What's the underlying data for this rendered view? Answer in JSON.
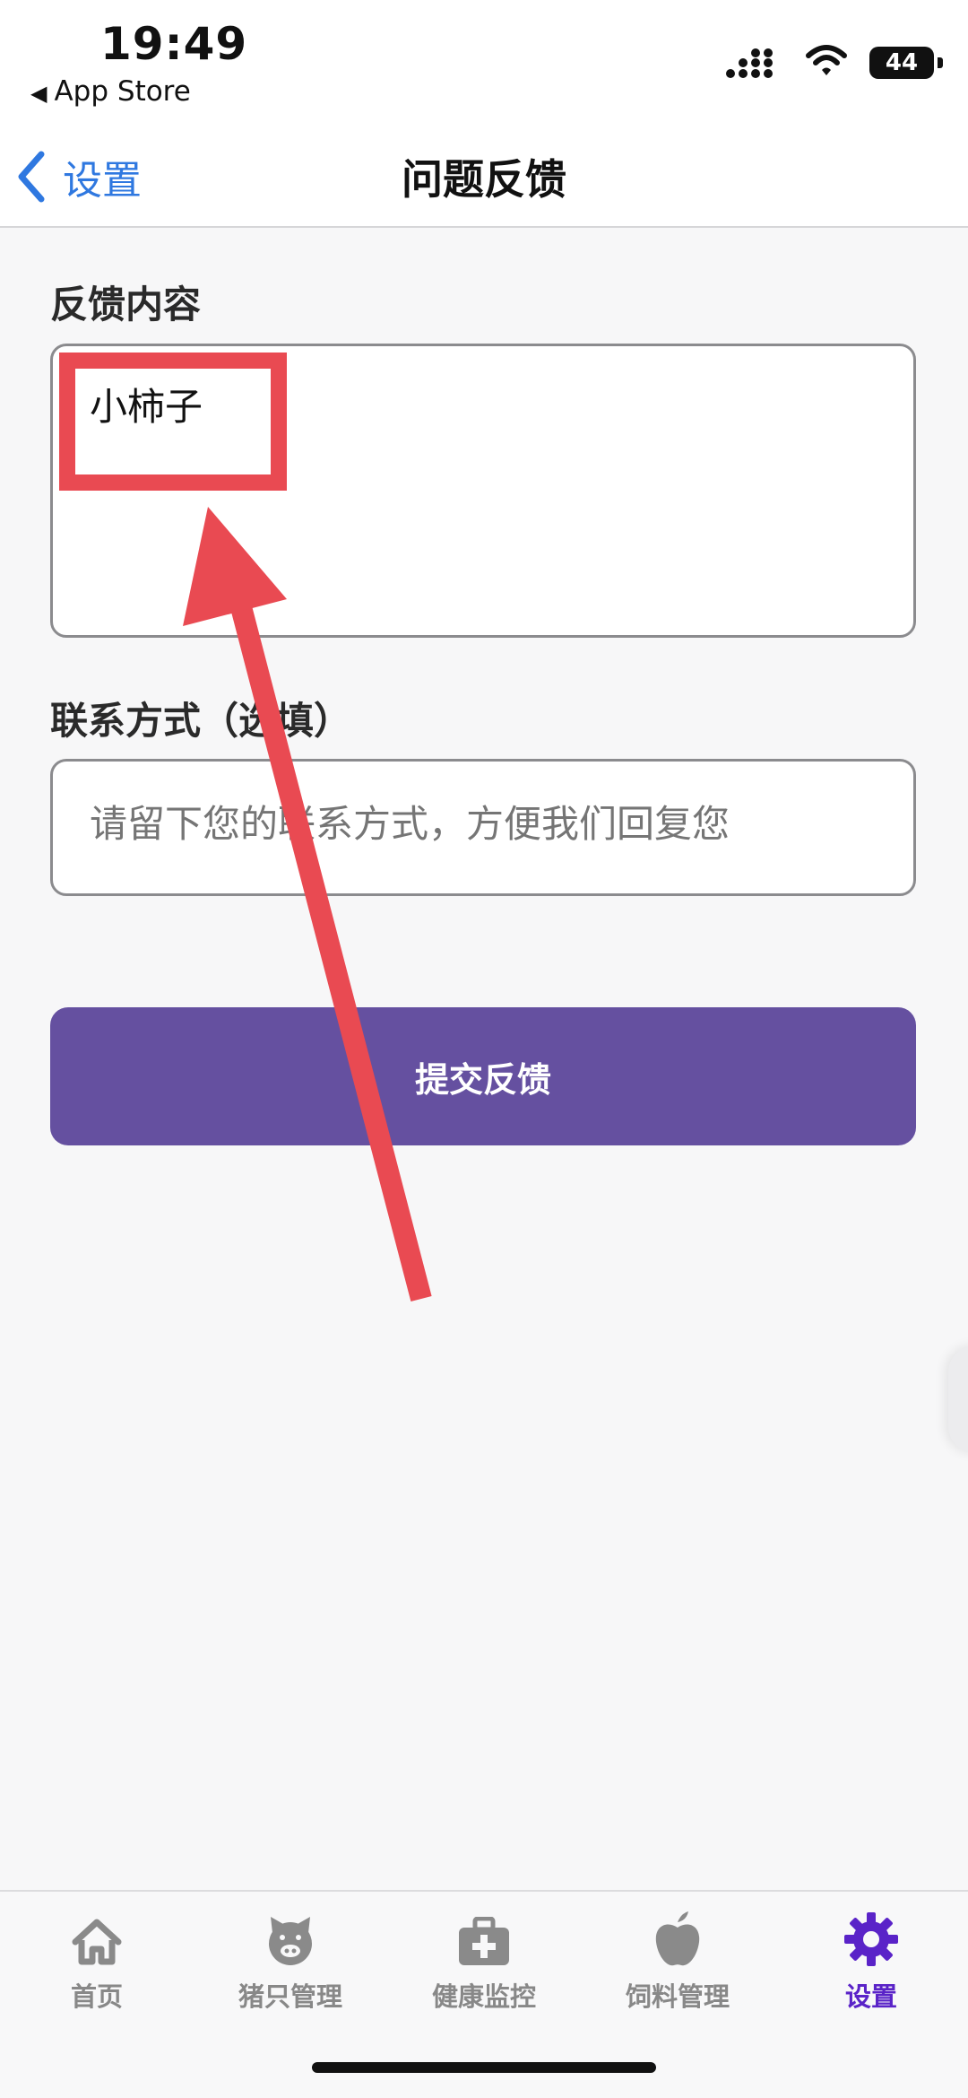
{
  "status": {
    "time": "19:49",
    "back_app": "App Store",
    "battery": "44"
  },
  "nav": {
    "back_label": "设置",
    "title": "问题反馈"
  },
  "form": {
    "feedback_label": "反馈内容",
    "feedback_value": "小柿子",
    "contact_label": "联系方式（选填）",
    "contact_placeholder": "请留下您的联系方式，方便我们回复您",
    "submit_label": "提交反馈"
  },
  "tabs": [
    {
      "label": "首页",
      "icon": "home-icon"
    },
    {
      "label": "猪只管理",
      "icon": "pig-icon"
    },
    {
      "label": "健康监控",
      "icon": "medical-kit-icon"
    },
    {
      "label": "饲料管理",
      "icon": "apple-icon"
    },
    {
      "label": "设置",
      "icon": "gear-icon",
      "active": true
    }
  ],
  "colors": {
    "accent": "#6550a0",
    "link": "#2f78e0",
    "active_tab": "#5a23c8",
    "annotation": "#e94a52"
  }
}
